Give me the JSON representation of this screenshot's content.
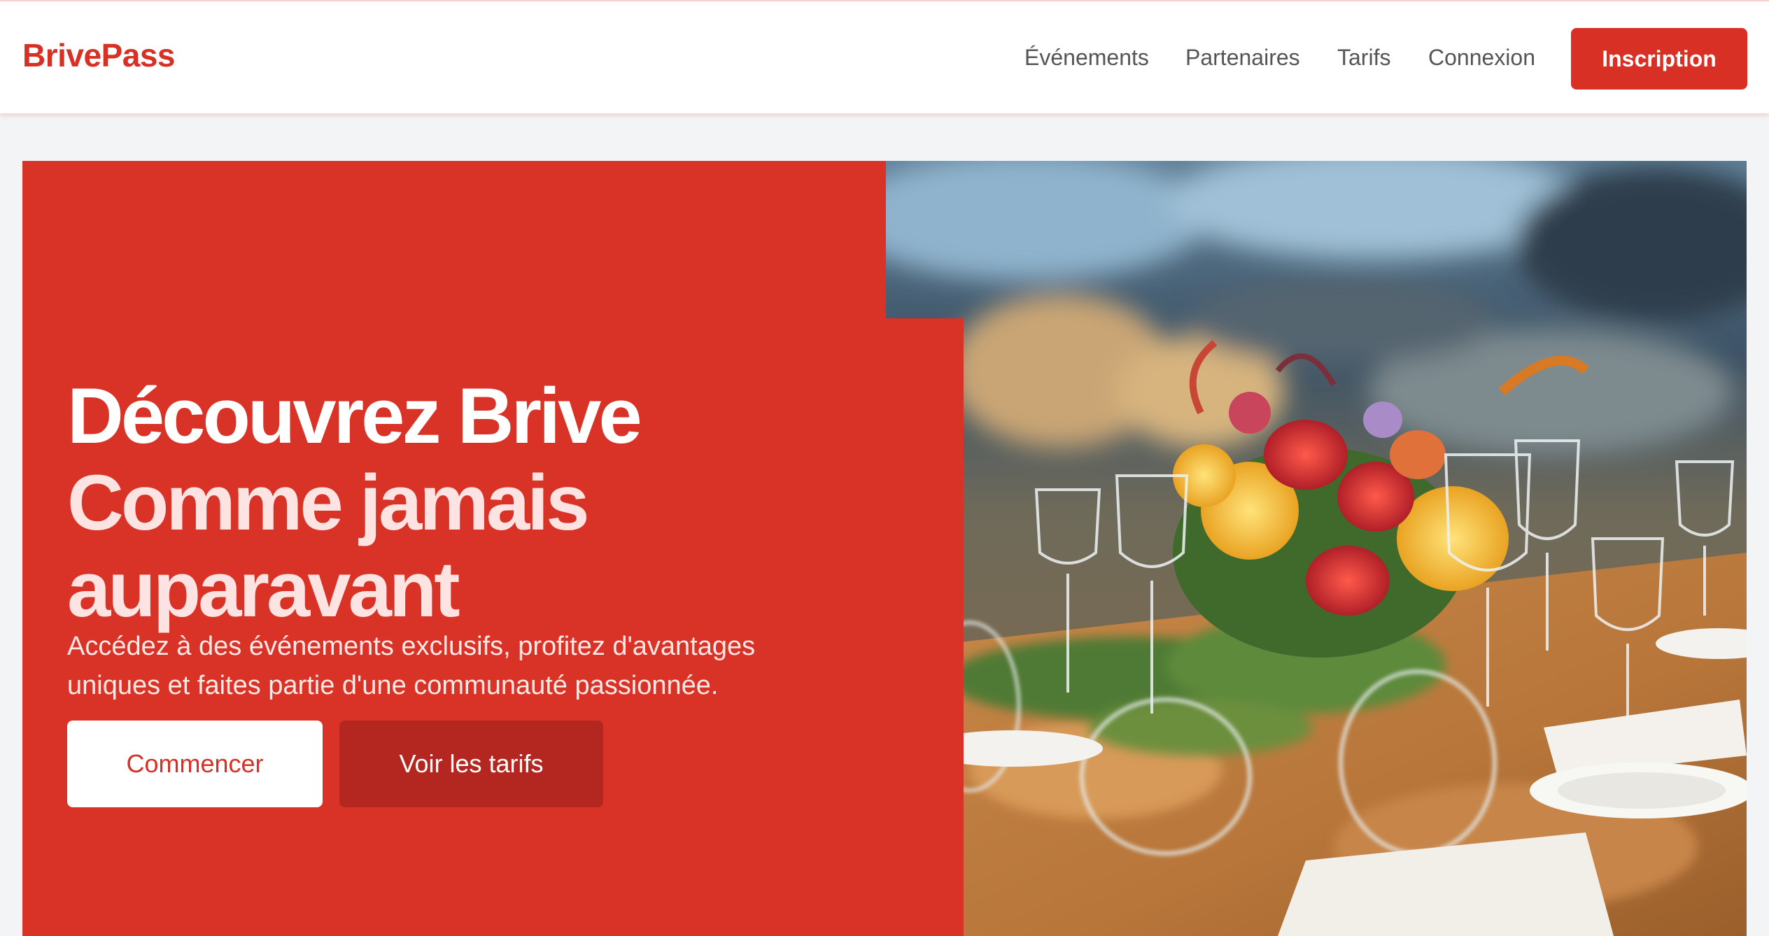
{
  "header": {
    "logo": "BrivePass",
    "nav": {
      "events": "Événements",
      "partners": "Partenaires",
      "tarifs": "Tarifs",
      "login": "Connexion"
    },
    "signup_label": "Inscription"
  },
  "hero": {
    "title_line1": "Découvrez Brive",
    "title_line2": "Comme jamais auparavant",
    "subtitle": "Accédez à des événements exclusifs, profitez d'avantages uniques et faites partie d'une communauté passionnée.",
    "primary_cta": "Commencer",
    "secondary_cta": "Voir les tarifs",
    "image_subject": "banquet-table-flowers-wine-glasses"
  },
  "colors": {
    "brand": "#d93025",
    "panel": "#d93328",
    "secondary_button": "#b42620",
    "page_background": "#f3f4f6"
  }
}
